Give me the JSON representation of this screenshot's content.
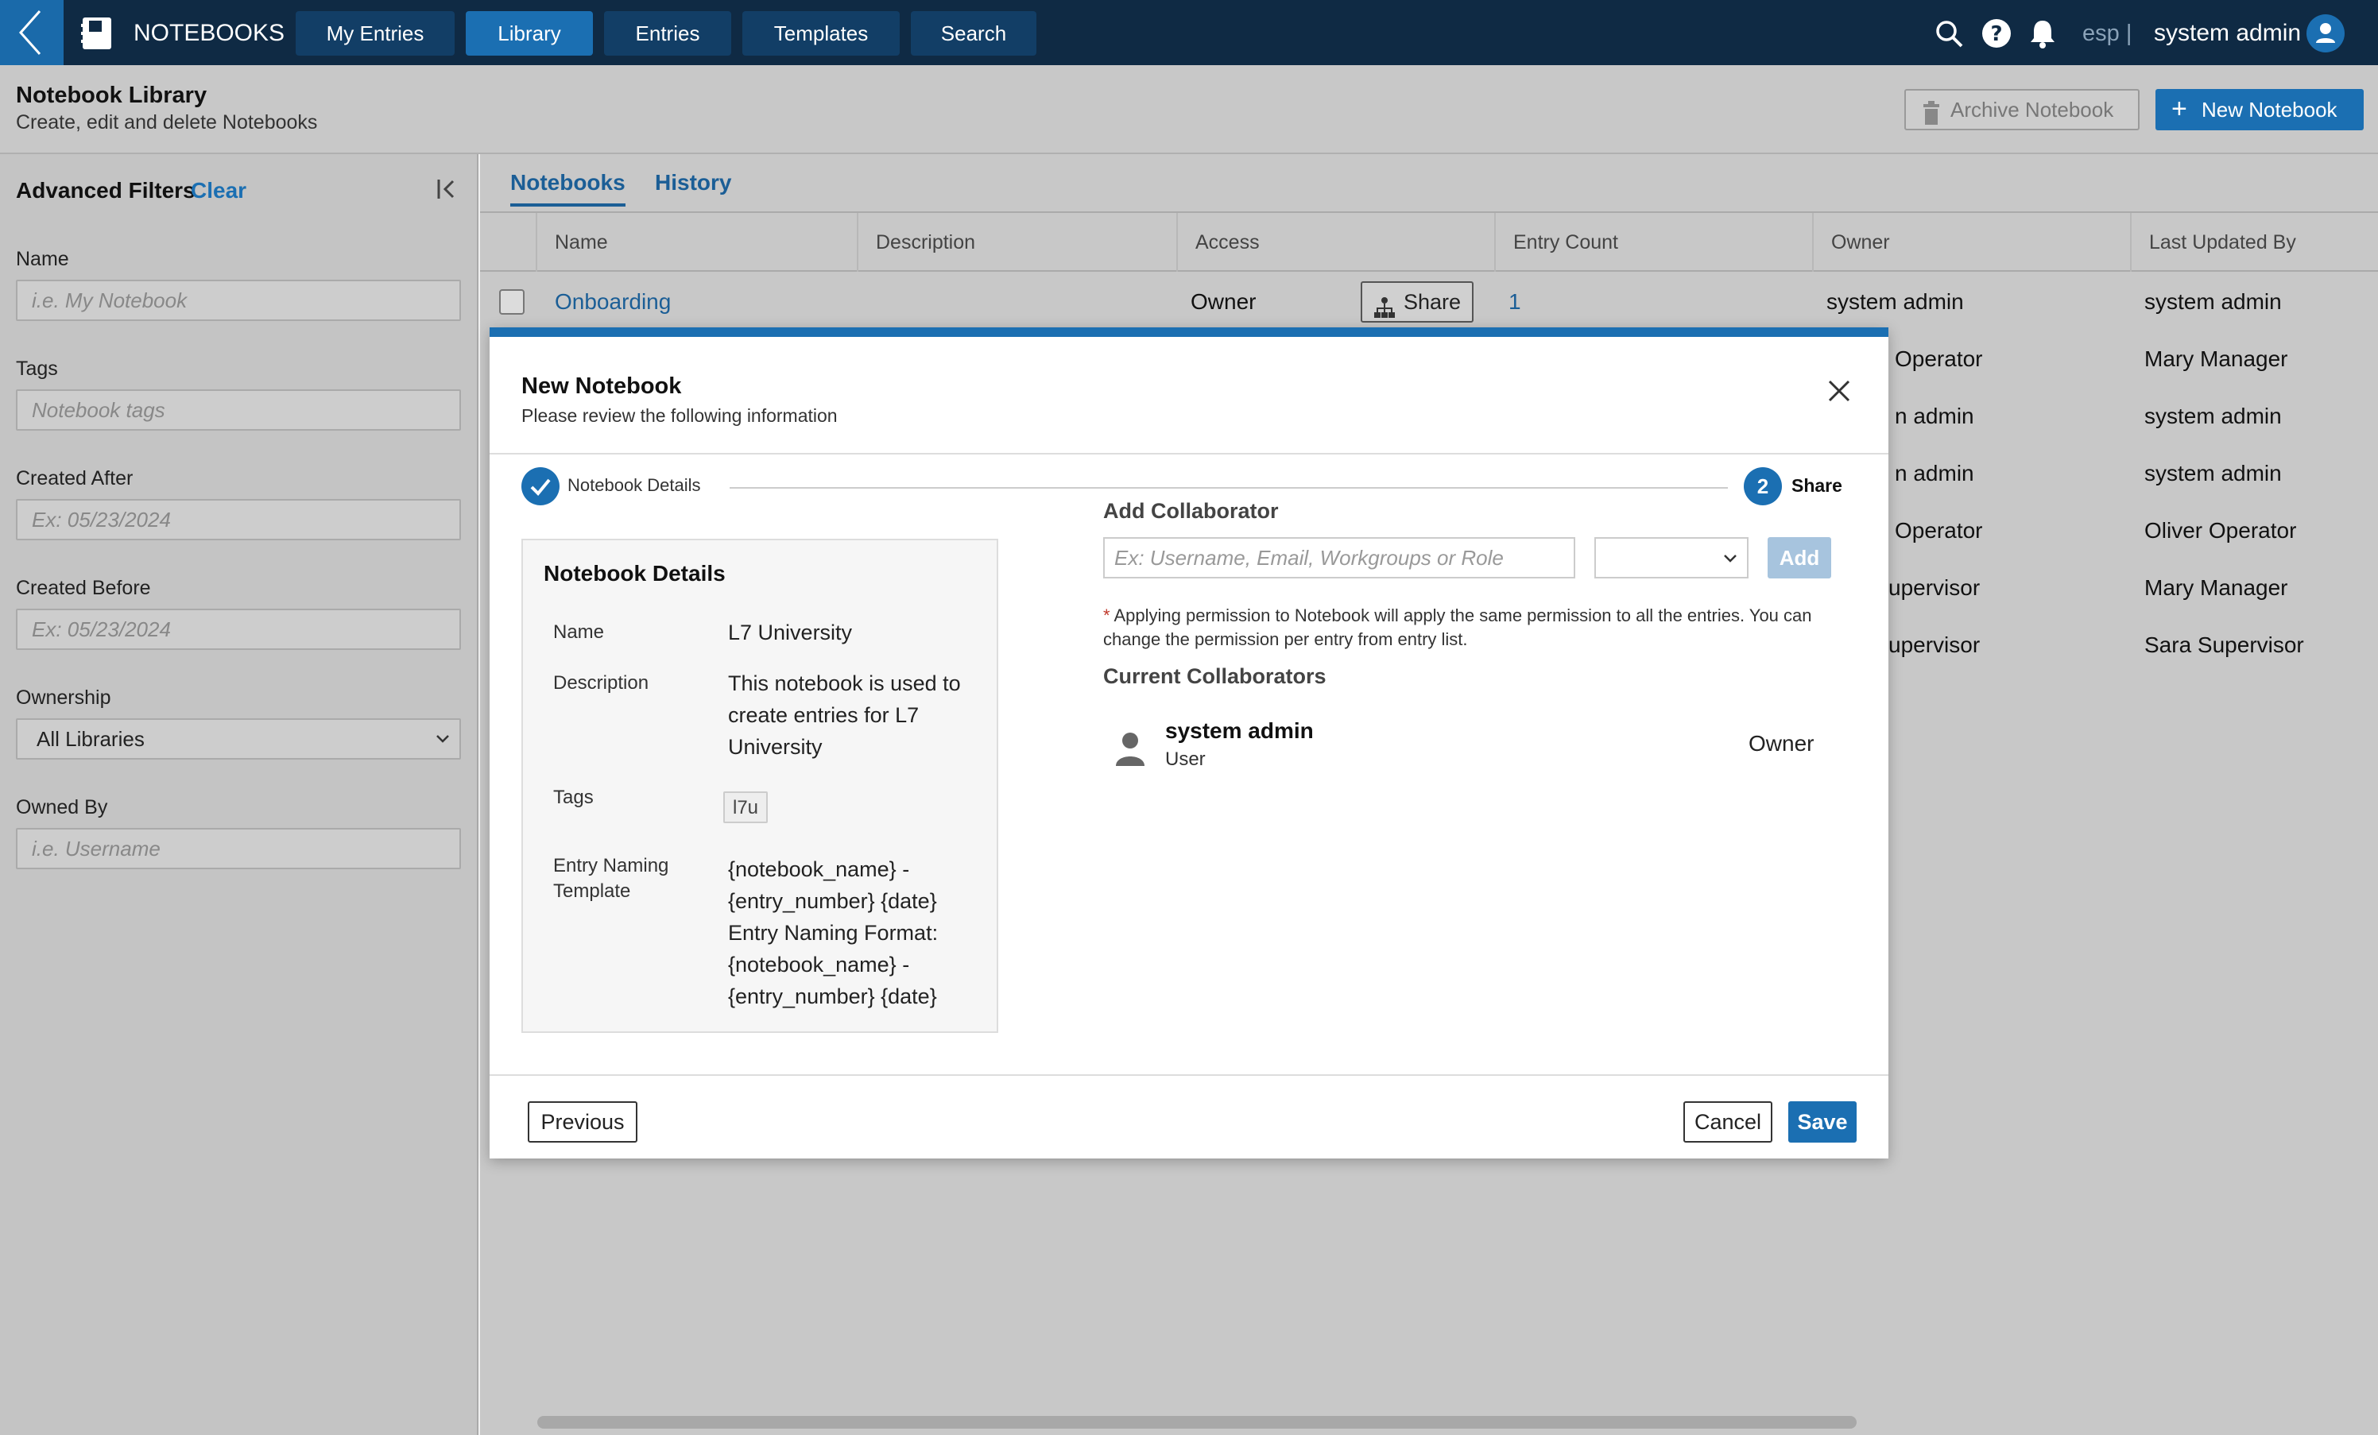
{
  "nav": {
    "app_title": "NOTEBOOKS",
    "tabs": [
      {
        "label": "My Entries"
      },
      {
        "label": "Library"
      },
      {
        "label": "Entries"
      },
      {
        "label": "Templates"
      },
      {
        "label": "Search"
      }
    ],
    "active_tab": "Library",
    "language": "esp |",
    "user_name": "system admin"
  },
  "header": {
    "title": "Notebook Library",
    "subtitle": "Create, edit and delete Notebooks",
    "archive_label": "Archive Notebook",
    "new_label": "New Notebook"
  },
  "filters": {
    "title": "Advanced Filters",
    "clear_label": "Clear",
    "name": {
      "label": "Name",
      "placeholder": "i.e. My Notebook"
    },
    "tags": {
      "label": "Tags",
      "placeholder": "Notebook tags"
    },
    "created_after": {
      "label": "Created After",
      "placeholder": "Ex: 05/23/2024"
    },
    "created_before": {
      "label": "Created Before",
      "placeholder": "Ex: 05/23/2024"
    },
    "ownership": {
      "label": "Ownership",
      "value": "All Libraries"
    },
    "owned_by": {
      "label": "Owned By",
      "placeholder": "i.e. Username"
    }
  },
  "main": {
    "tabs": [
      {
        "label": "Notebooks"
      },
      {
        "label": "History"
      }
    ],
    "columns": [
      "Name",
      "Description",
      "Access",
      "Entry Count",
      "Owner",
      "Last Updated By"
    ],
    "first_row": {
      "name": "Onboarding",
      "access": "Owner",
      "share_label": "Share",
      "entry_count": "1",
      "owner": "system admin",
      "last_updated_by": "system admin"
    },
    "rows_partial": [
      {
        "owner": "Operator",
        "last_updated_by": "Mary Manager"
      },
      {
        "owner": "n admin",
        "last_updated_by": "system admin"
      },
      {
        "owner": "n admin",
        "last_updated_by": "system admin"
      },
      {
        "owner": "Operator",
        "last_updated_by": "Oliver Operator"
      },
      {
        "owner": "upervisor",
        "last_updated_by": "Mary Manager"
      },
      {
        "owner": "upervisor",
        "last_updated_by": "Sara Supervisor"
      }
    ]
  },
  "modal": {
    "title": "New Notebook",
    "subtitle": "Please review the following information",
    "steps": [
      {
        "label": "Notebook Details",
        "state": "complete"
      },
      {
        "label": "Share",
        "number": "2",
        "state": "active"
      }
    ],
    "details": {
      "title": "Notebook Details",
      "name_label": "Name",
      "name_value": "L7 University",
      "description_label": "Description",
      "description_value": "This notebook is used to create entries for L7 University",
      "tags_label": "Tags",
      "tag_value": "l7u",
      "template_label": "Entry Naming Template",
      "template_value": "{notebook_name} - {entry_number} {date} Entry Naming Format: {notebook_name} - {entry_number} {date}"
    },
    "share": {
      "add_title": "Add Collaborator",
      "input_placeholder": "Ex: Username, Email, Workgroups or Role",
      "add_label": "Add",
      "note_star": "*",
      "note": " Applying permission to Notebook will apply the same permission to all the entries. You can change the permission per entry from entry list.",
      "current_title": "Current Collaborators",
      "collaborator": {
        "name": "system admin",
        "type": "User",
        "role": "Owner"
      }
    },
    "footer": {
      "previous_label": "Previous",
      "cancel_label": "Cancel",
      "save_label": "Save"
    }
  },
  "colors": {
    "primary": "#1b6fb2",
    "navbar": "#0f2a44",
    "overlay": "#c8c8c8"
  }
}
